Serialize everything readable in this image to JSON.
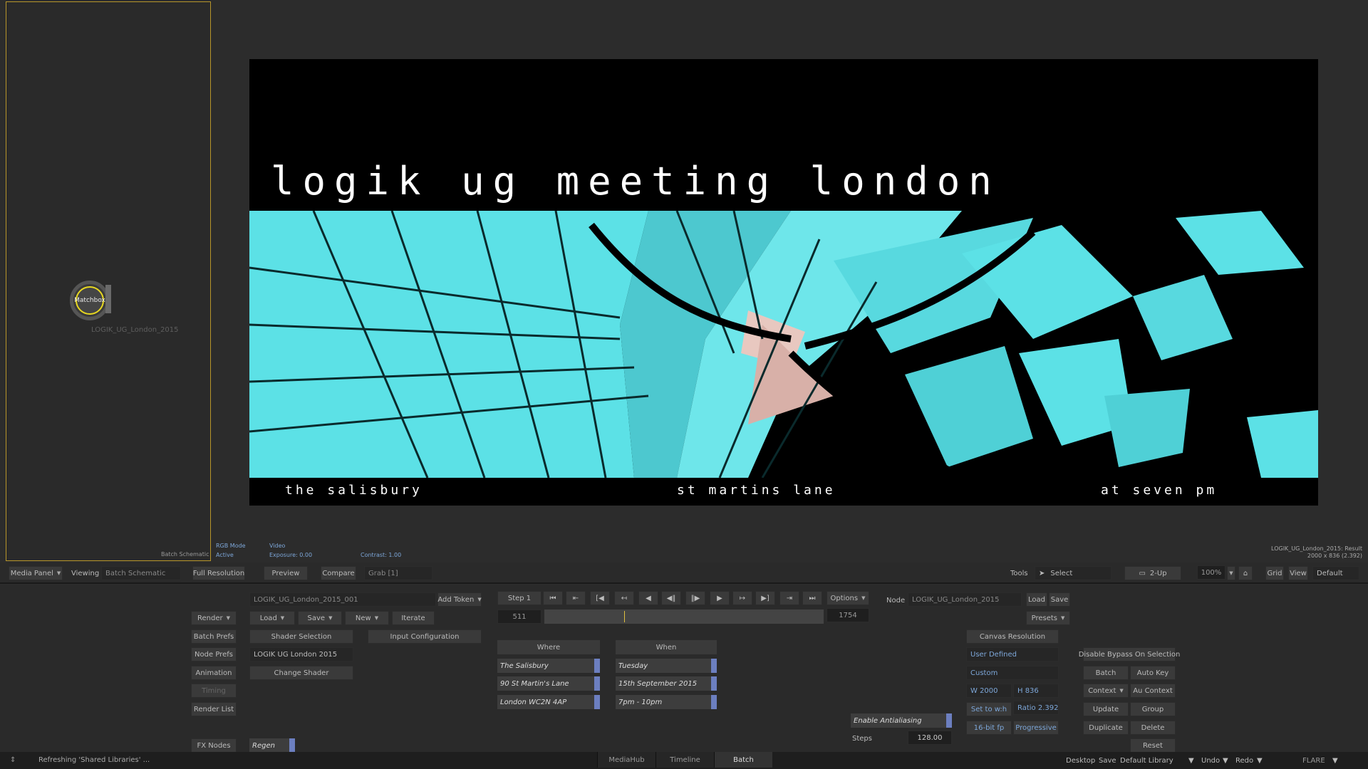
{
  "schematic": {
    "node_label": "Matchbox",
    "node_name": "LOGIK_UG_London_2015",
    "panel_label": "Batch Schematic"
  },
  "viewer_info": {
    "rgb_mode": "RGB Mode",
    "active": "Active",
    "video": "Video",
    "exposure": "Exposure: 0.00",
    "contrast": "Contrast: 1.00",
    "result_name": "LOGIK_UG_London_2015: Result",
    "result_res": "2000 x 836 (2.392)"
  },
  "image": {
    "title": "logik ug meeting london",
    "bottom_left": "the salisbury",
    "bottom_mid": "st martins lane",
    "bottom_right": "at seven pm"
  },
  "controlbar": {
    "media_panel": "Media Panel",
    "viewing": "Viewing",
    "viewing_value": "Batch Schematic",
    "full_resolution": "Full Resolution",
    "preview": "Preview",
    "compare": "Compare",
    "grab": "Grab [1]",
    "tools": "Tools",
    "select": "Select",
    "two_up": "2-Up",
    "zoom": "100%",
    "grid": "Grid",
    "view": "View",
    "default": "Default"
  },
  "panel": {
    "render": "Render",
    "batch_prefs": "Batch Prefs",
    "node_prefs": "Node Prefs",
    "animation": "Animation",
    "timing": "Timing",
    "render_list": "Render List",
    "fx_nodes": "FX Nodes",
    "setup_name": "LOGIK_UG_London_2015_001",
    "add_token": "Add Token",
    "load": "Load",
    "save": "Save",
    "new": "New",
    "iterate": "Iterate",
    "shader_selection": "Shader Selection",
    "input_configuration": "Input Configuration",
    "shader_name": "LOGIK UG London 2015",
    "change_shader": "Change Shader",
    "regen": "Regen",
    "step": "Step 1",
    "options": "Options",
    "frame_start": "511",
    "frame_end": "1754",
    "where": "Where",
    "when": "When",
    "where_fields": [
      "The Salisbury",
      "90 St Martin's Lane",
      "London WC2N 4AP"
    ],
    "when_fields": [
      "Tuesday",
      "15th September 2015",
      "7pm - 10pm"
    ],
    "enable_antialiasing": "Enable Antialiasing",
    "steps": "Steps",
    "steps_value": "128.00",
    "node": "Node",
    "node_value": "LOGIK_UG_London_2015",
    "node_load": "Load",
    "node_save": "Save",
    "presets": "Presets",
    "canvas_resolution": "Canvas Resolution",
    "user_defined": "User Defined",
    "custom": "Custom",
    "width": "W 2000",
    "height": "H 836",
    "set_to_wh": "Set to w:h",
    "ratio": "Ratio 2.392",
    "bit_depth": "16-bit fp",
    "progressive": "Progressive",
    "disable_bypass": "Disable Bypass On Selection",
    "batch": "Batch",
    "auto_key": "Auto Key",
    "context": "Context",
    "au_context": "Au Context",
    "update": "Update",
    "group": "Group",
    "duplicate": "Duplicate",
    "delete": "Delete",
    "reset": "Reset"
  },
  "statusbar": {
    "message": "Refreshing 'Shared Libraries' ...",
    "tabs": [
      "MediaHub",
      "Timeline",
      "Batch"
    ],
    "desktop": "Desktop",
    "save": "Save",
    "library": "Default Library",
    "undo": "Undo",
    "redo": "Redo",
    "app": "FLARE"
  },
  "colors": {
    "schematic_border": "#b8962a",
    "accent_blue": "#6c7fc0",
    "image_cyan": "#5ce1e6"
  }
}
